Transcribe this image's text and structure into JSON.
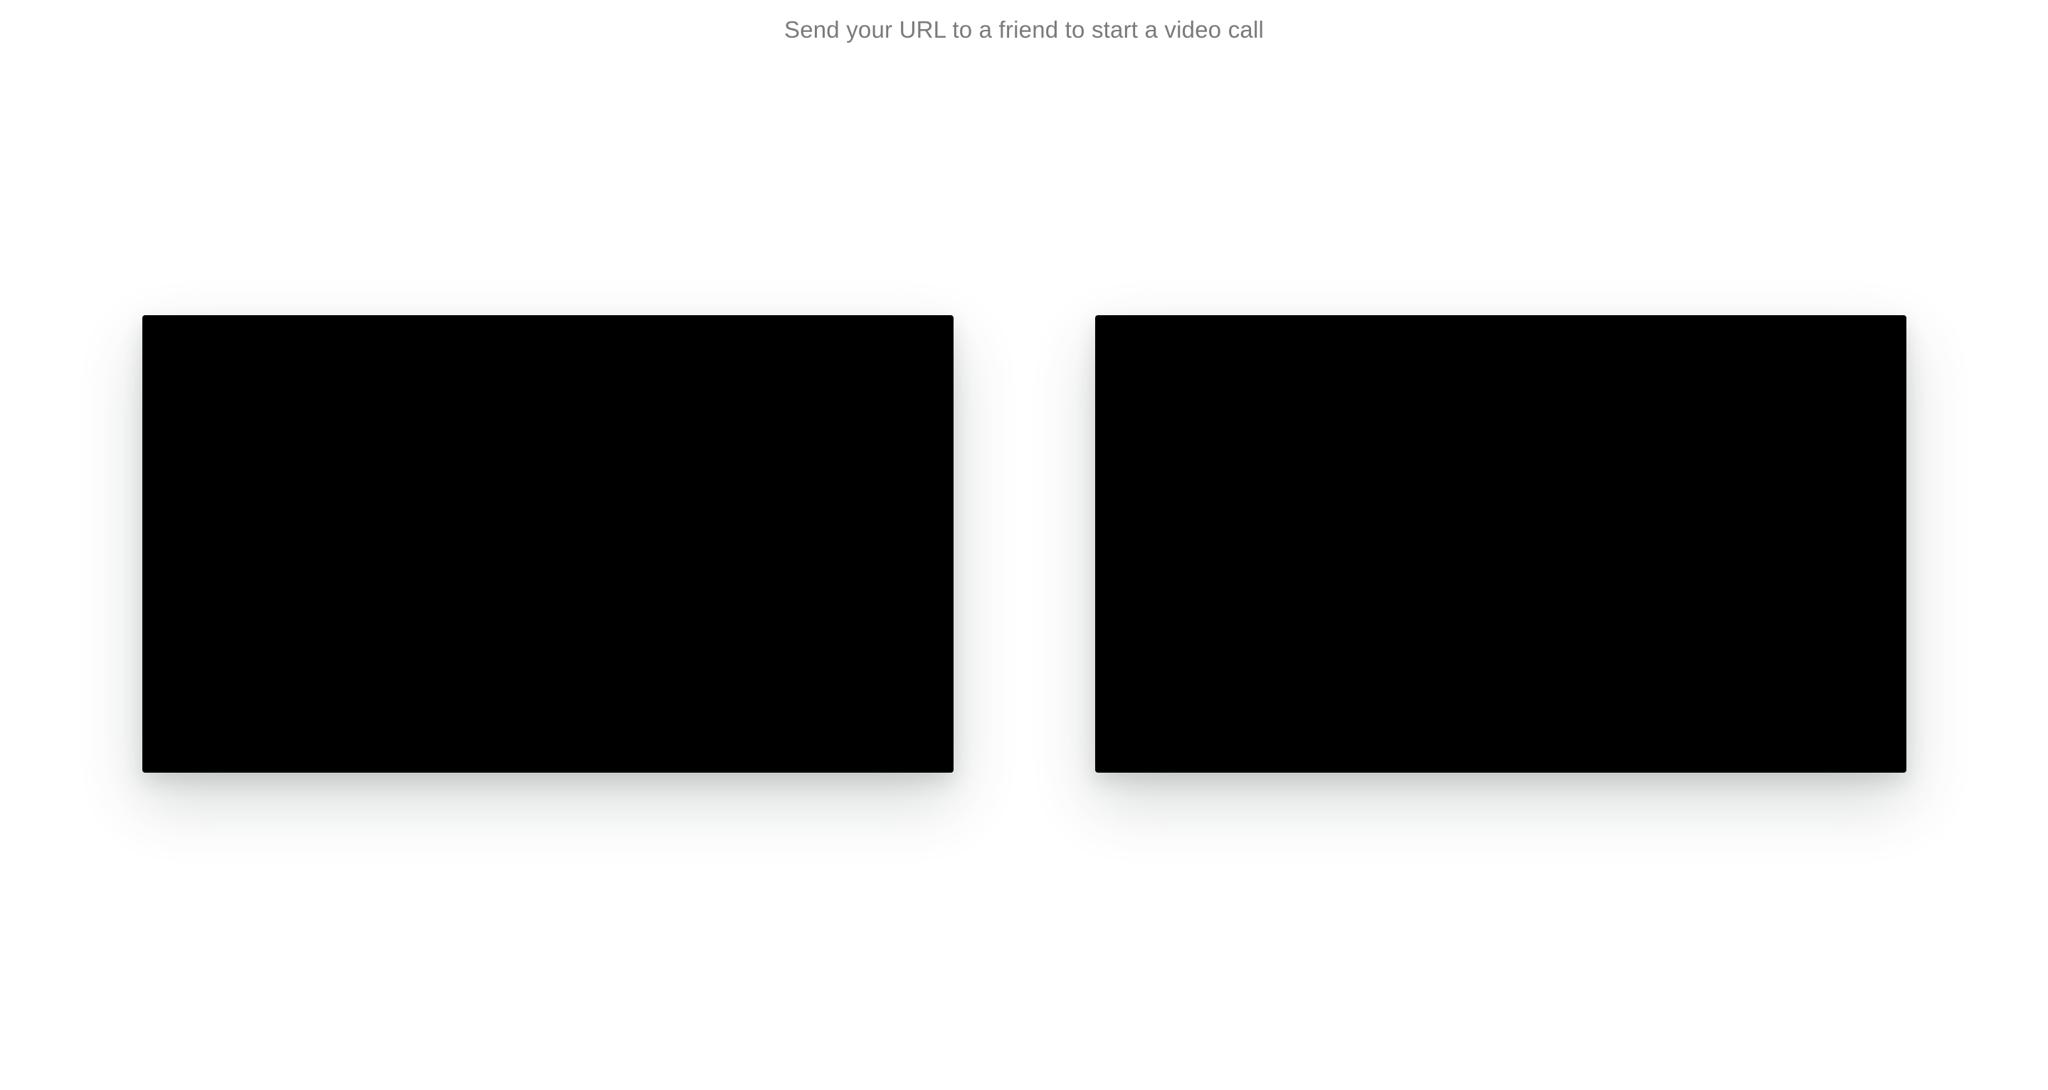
{
  "header": {
    "instruction": "Send your URL to a friend to start a video call"
  },
  "videos": {
    "local": {
      "background": "#000000"
    },
    "remote": {
      "background": "#000000"
    }
  },
  "colors": {
    "page_background": "#ffffff",
    "instruction_text": "#7a7a7a",
    "video_background": "#000000"
  }
}
